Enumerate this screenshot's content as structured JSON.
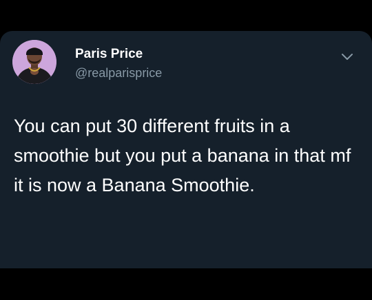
{
  "tweet": {
    "author_name": "Paris Price",
    "author_handle": "@realparisprice",
    "text": "You can put 30 different fruits in a smoothie but you put a banana in that mf it is now a Banana Smoothie."
  },
  "icons": {
    "menu": "chevron-down-icon",
    "avatar": "avatar"
  },
  "colors": {
    "card_background": "#15202b",
    "page_background": "#000000",
    "name_text": "#ffffff",
    "handle_text": "#8899a6",
    "tweet_text": "#ffffff"
  }
}
